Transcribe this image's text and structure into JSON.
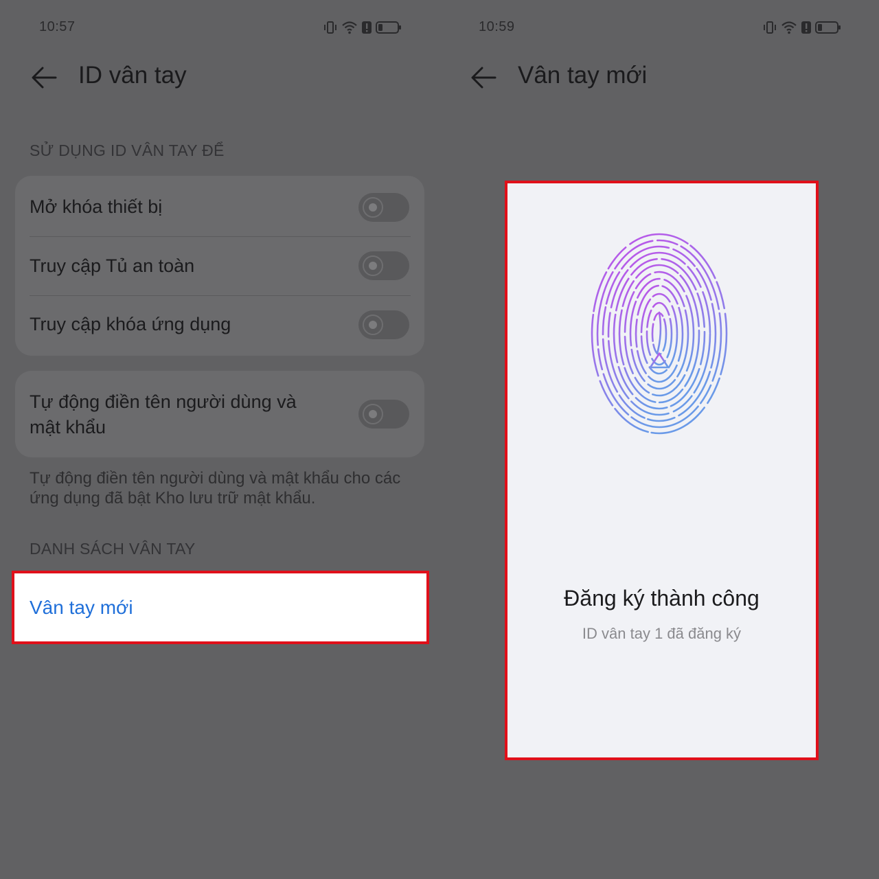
{
  "left_screen": {
    "status_time": "10:57",
    "title": "ID vân tay",
    "section_use": "SỬ DỤNG ID VÂN TAY ĐỂ",
    "options": [
      {
        "label": "Mở khóa thiết bị",
        "enabled": false
      },
      {
        "label": "Truy cập Tủ an toàn",
        "enabled": false
      },
      {
        "label": "Truy cập khóa ứng dụng",
        "enabled": false
      }
    ],
    "autofill": {
      "label_line1": "Tự động điền tên người dùng và",
      "label_line2": "mật khẩu",
      "enabled": false
    },
    "autofill_note": "Tự động điền tên người dùng và mật khẩu cho các ứng dụng đã bật Kho lưu trữ mật khẩu.",
    "section_list": "DANH SÁCH VÂN TAY",
    "new_fingerprint": "Vân tay mới"
  },
  "right_screen": {
    "status_time": "10:59",
    "title": "Vân tay mới",
    "success_title": "Đăng ký thành công",
    "success_subtitle": "ID vân tay 1 đã đăng ký"
  },
  "icons": [
    "vibrate-icon",
    "wifi-icon",
    "alert-icon",
    "battery-icon",
    "back-arrow-icon",
    "fingerprint-icon"
  ],
  "colors": {
    "highlight_border": "#e0101a",
    "link_blue": "#1f6fd9",
    "dim_overlay": "#616163",
    "panel_bg": "#f1f2f6"
  }
}
